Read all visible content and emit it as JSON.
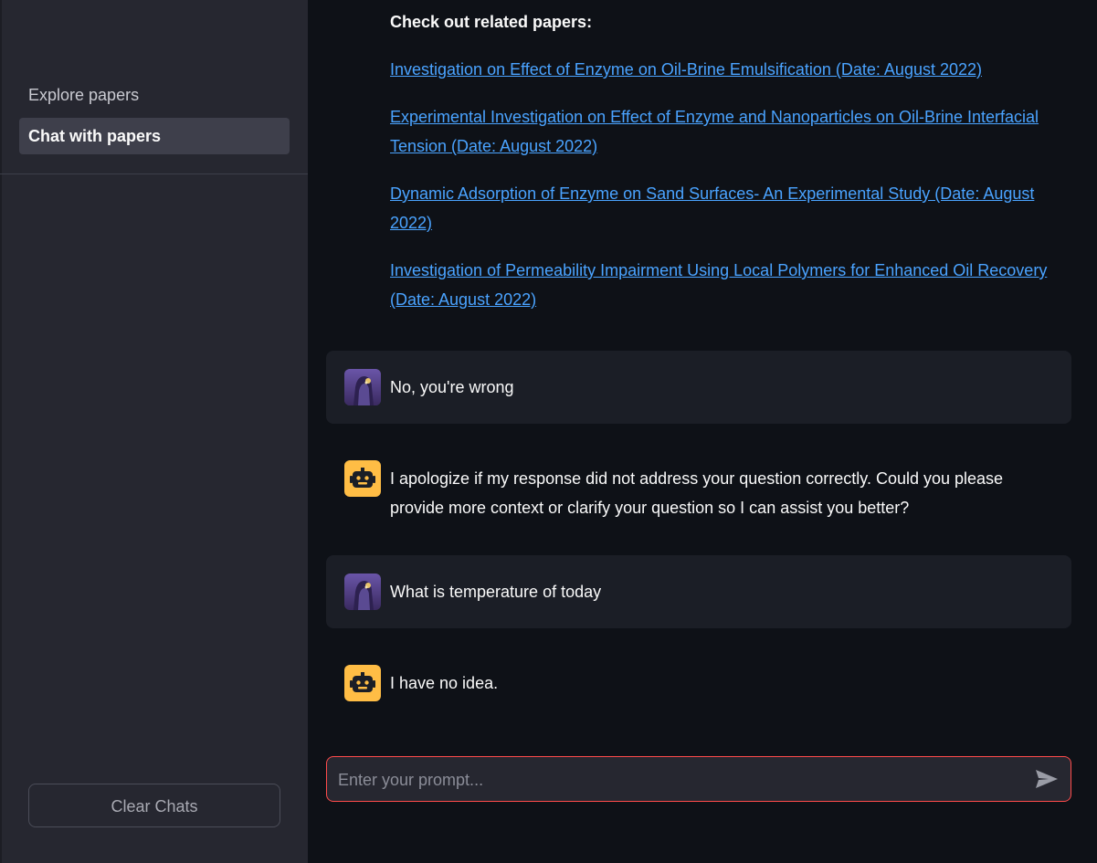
{
  "sidebar": {
    "nav": [
      {
        "label": "Explore papers",
        "active": false
      },
      {
        "label": "Chat with papers",
        "active": true
      }
    ],
    "clear_button": "Clear Chats"
  },
  "related": {
    "heading": "Check out related papers:",
    "papers": [
      "Investigation on Effect of Enzyme on Oil-Brine Emulsification (Date: August 2022)",
      "Experimental Investigation on Effect of Enzyme and Nanoparticles on Oil-Brine Interfacial Tension (Date: August 2022)",
      "Dynamic Adsorption of Enzyme on Sand Surfaces- An Experimental Study (Date: August 2022)",
      "Investigation of Permeability Impairment Using Local Polymers for Enhanced Oil Recovery (Date: August 2022)"
    ]
  },
  "messages": [
    {
      "role": "user",
      "text": "No, you're wrong",
      "avatar": "user-avatar-icon"
    },
    {
      "role": "assistant",
      "text": "I apologize if my response did not address your question correctly. Could you please provide more context or clarify your question so I can assist you better?",
      "avatar": "robot-icon"
    },
    {
      "role": "user",
      "text": "What is temperature of today",
      "avatar": "user-avatar-icon"
    },
    {
      "role": "assistant",
      "text": "I have no idea.",
      "avatar": "robot-icon"
    }
  ],
  "prompt": {
    "placeholder": "Enter your prompt...",
    "value": ""
  },
  "colors": {
    "background": "#0e1117",
    "sidebar": "#262730",
    "link": "#4aa3ff",
    "bot_avatar": "#ffbd45",
    "prompt_border": "#ff4b4b"
  }
}
